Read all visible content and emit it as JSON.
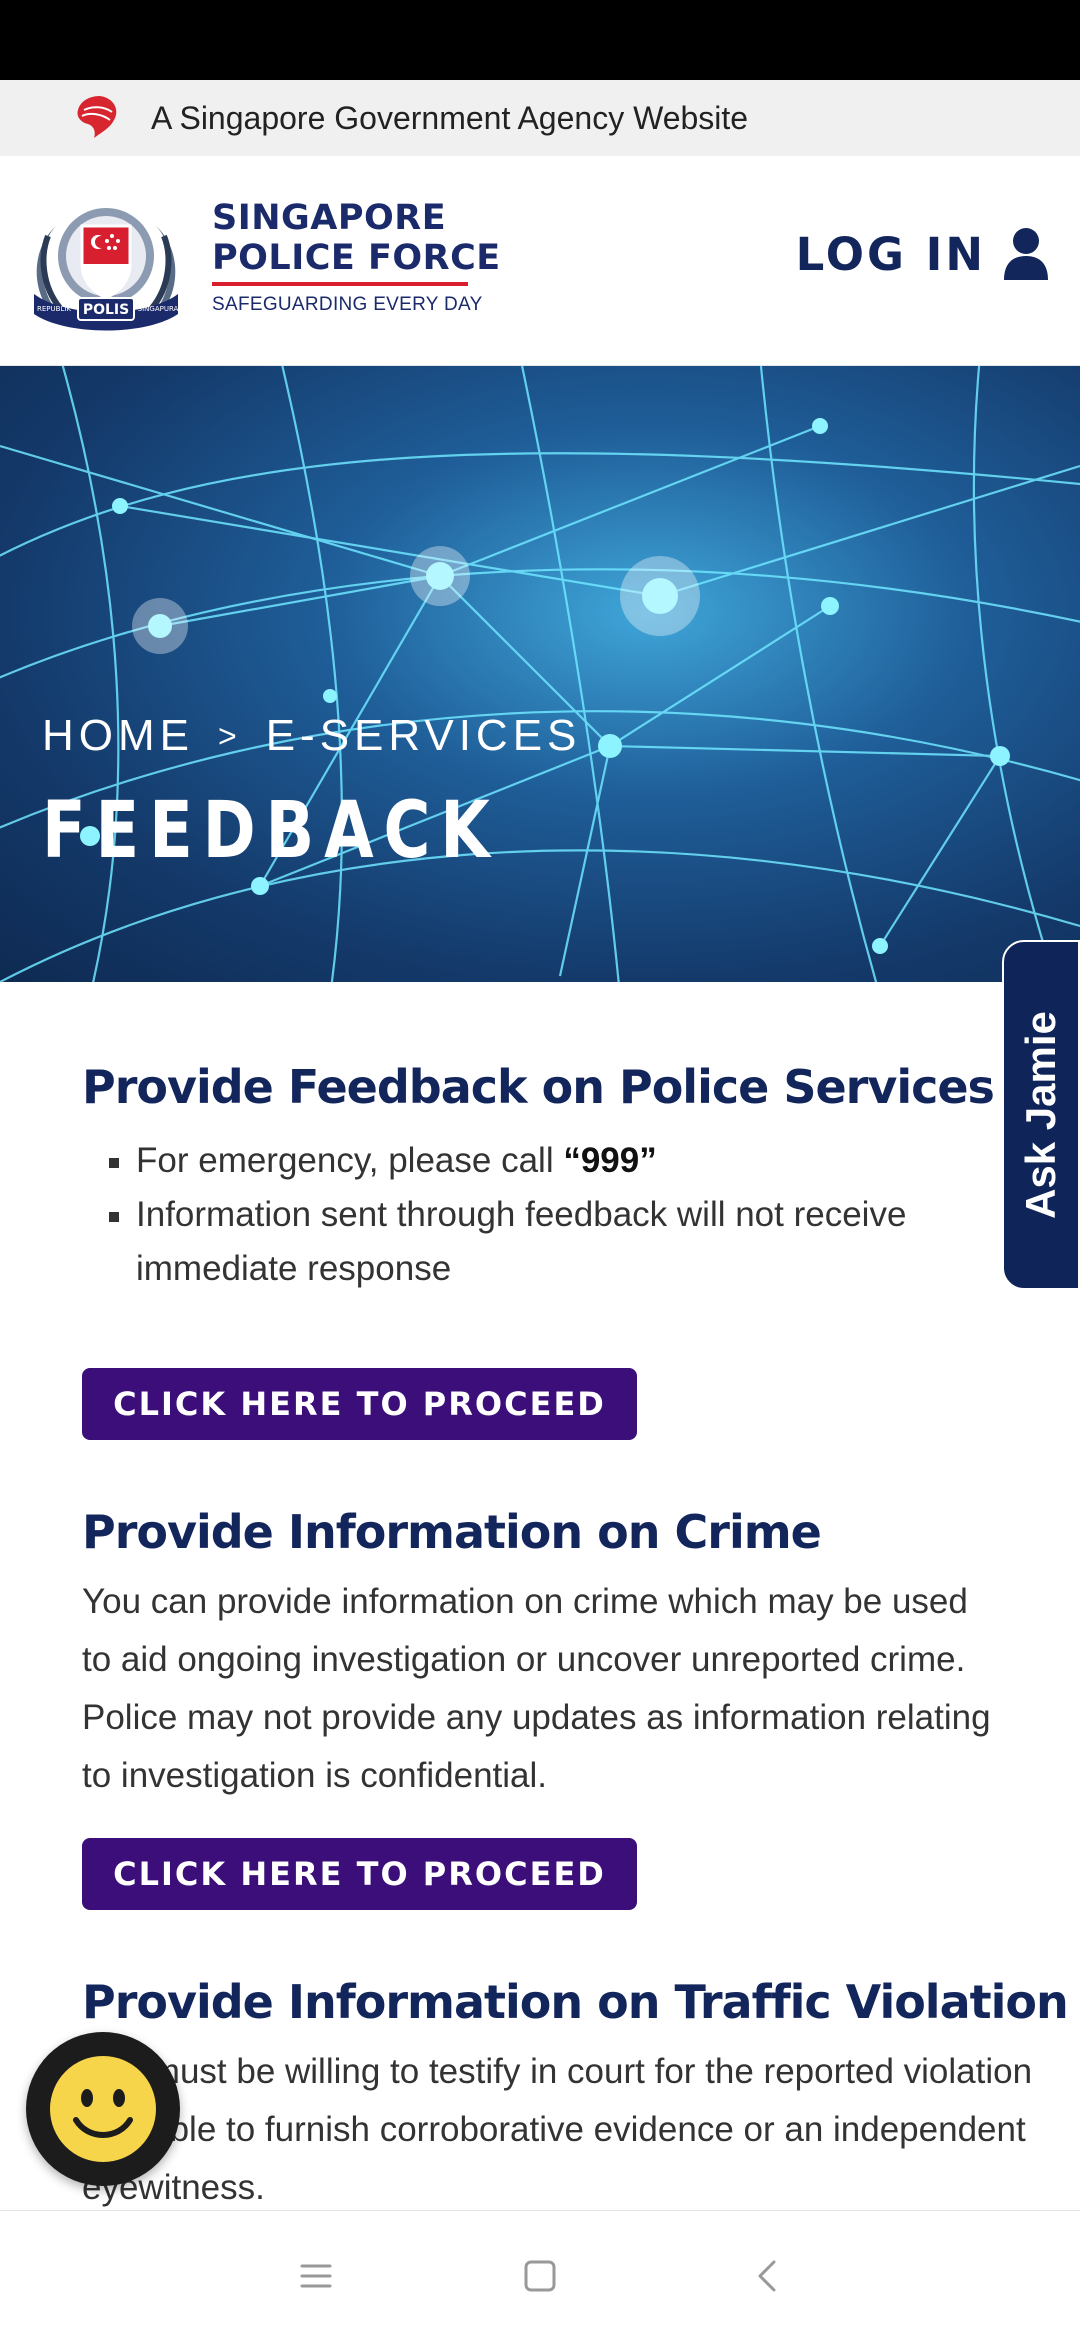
{
  "gov_banner": {
    "text": "A Singapore Government Agency Website",
    "icon": "lion-head-icon",
    "icon_color": "#d7262f"
  },
  "header": {
    "logo_line1": "SINGAPORE",
    "logo_line2": "POLICE FORCE",
    "logo_tagline": "SAFEGUARDING EVERY DAY",
    "crest_label": "POLIS",
    "crest_left": "REPUBLIK",
    "crest_right": "SINGAPURA",
    "login_label": "LOG IN",
    "login_icon": "user-icon"
  },
  "hero": {
    "breadcrumb": {
      "home": "HOME",
      "separator": ">",
      "current": "E-SERVICES"
    },
    "title": "FEEDBACK"
  },
  "ask_jamie": {
    "label": "Ask Jamie"
  },
  "sections": [
    {
      "title": "Provide Feedback on Police Services",
      "bullets": [
        {
          "text": "For emergency, please call ",
          "bold": "“999”"
        },
        {
          "text": "Information sent through feedback will not receive immediate response"
        }
      ],
      "button_label": "CLICK HERE TO PROCEED"
    },
    {
      "title": "Provide Information on Crime",
      "body": "You can provide information on crime which may be used to aid ongoing investigation or uncover unreported crime. Police may not provide any updates as information relating to investigation is confidential.",
      "button_label": "CLICK HERE TO PROCEED"
    },
    {
      "title": "Provide Information on Traffic Violation",
      "body": "You must be willing to testify in court for the reported violation and able to furnish corroborative evidence or an independent eyewitness."
    }
  ],
  "chat_fab": {
    "icon": "smiley-face-icon"
  },
  "nav_bar": {
    "items": [
      "menu-icon",
      "home-square-icon",
      "back-chevron-icon"
    ]
  },
  "colors": {
    "navy": "#13265c",
    "button_purple": "#3b0e7a",
    "accent_red": "#d71f2f",
    "gov_banner_bg": "#f0f0f0"
  }
}
